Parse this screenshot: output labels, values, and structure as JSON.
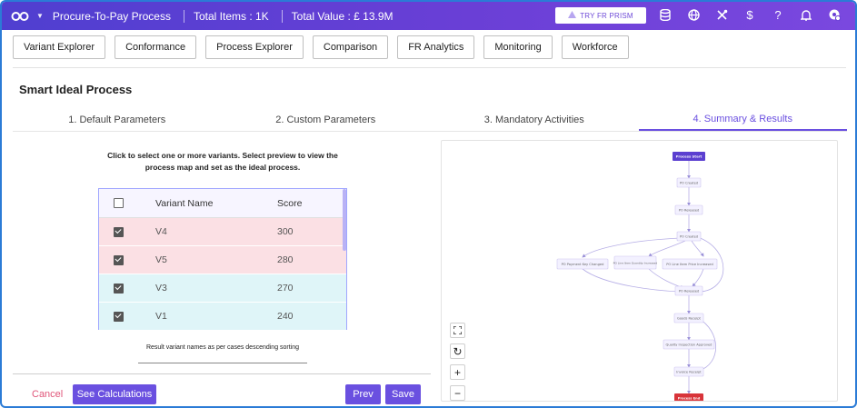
{
  "topbar": {
    "title": "Procure-To-Pay Process",
    "total_items": "Total Items : 1K",
    "total_value": "Total Value : £ 13.9M",
    "try_button": "TRY FR PRISM"
  },
  "nav": {
    "items": [
      "Variant Explorer",
      "Conformance",
      "Process Explorer",
      "Comparison",
      "FR Analytics",
      "Monitoring",
      "Workforce"
    ]
  },
  "page": {
    "title": "Smart Ideal Process"
  },
  "steps": [
    {
      "label": "1. Default Parameters"
    },
    {
      "label": "2. Custom Parameters"
    },
    {
      "label": "3. Mandatory Activities"
    },
    {
      "label": "4. Summary & Results"
    }
  ],
  "panel": {
    "instruction": "Click to select one or more variants. Select preview to view the process map and set as the ideal process.",
    "note": "Result variant names as per cases descending sorting"
  },
  "table": {
    "headers": [
      "Variant Name",
      "Score"
    ],
    "rows": [
      {
        "name": "V4",
        "score": "300",
        "checked": true,
        "color": "#fbe0e4"
      },
      {
        "name": "V5",
        "score": "280",
        "checked": true,
        "color": "#fbe0e4"
      },
      {
        "name": "V3",
        "score": "270",
        "checked": true,
        "color": "#dff5f8"
      },
      {
        "name": "V1",
        "score": "240",
        "checked": true,
        "color": "#dff5f8"
      }
    ]
  },
  "process_map": {
    "nodes": {
      "start": "Process Start",
      "po_created": "PO Created",
      "po_released_1": "PO Released",
      "po_created_2": "PO Created",
      "payment_key": "PO Payment Key Changed",
      "qty_increased": "PO Line Item Quantity Increased",
      "price_increased": "PO Line Item Price Increased",
      "po_released_2": "PO Released",
      "goods_receipt": "Goods Receipt",
      "quality": "Quality Inspection Approved",
      "invoice": "Invoice Receipt",
      "end": "Process End"
    }
  },
  "controls": {
    "fit": "⛶",
    "reset": "↻",
    "zoom_in": "+",
    "zoom_out": "−"
  },
  "footer": {
    "cancel": "Cancel",
    "see_calculations": "See Calculations",
    "prev": "Prev",
    "save": "Save"
  },
  "colors": {
    "accent": "#6a50e0",
    "topbar_start": "#4f3fd0",
    "topbar_end": "#7a48df",
    "cancel": "#e0567a",
    "start_node": "#5b3fd0",
    "end_node": "#d8343a"
  }
}
